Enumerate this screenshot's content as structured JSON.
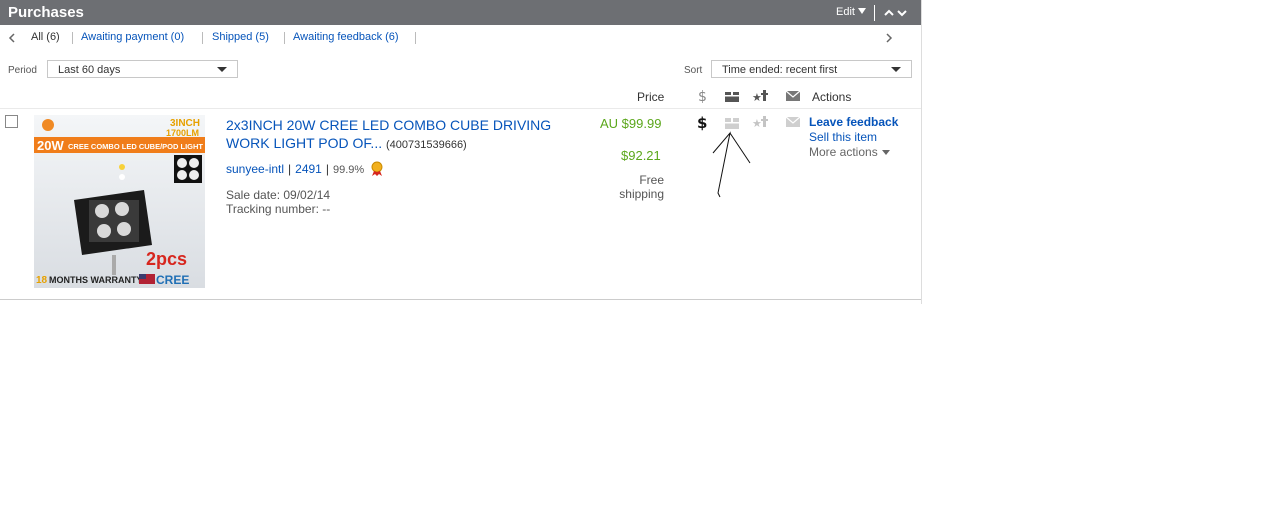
{
  "header": {
    "title": "Purchases",
    "edit_label": "Edit"
  },
  "tabs": [
    {
      "label": "All (6)"
    },
    {
      "label": "Awaiting payment (0)"
    },
    {
      "label": "Shipped (5)"
    },
    {
      "label": "Awaiting feedback (6)"
    }
  ],
  "filters": {
    "period_label": "Period",
    "period_value": "Last 60 days",
    "sort_label": "Sort",
    "sort_value": "Time ended: recent first"
  },
  "columns": {
    "price": "Price",
    "actions": "Actions"
  },
  "item": {
    "title": "2x3INCH 20W CREE LED COMBO CUBE DRIVING WORK LIGHT POD OF...",
    "item_number": "(400731539666)",
    "seller": "sunyee-intl",
    "feedback_score": "2491",
    "feedback_percent": "99.9%",
    "sale_date": "Sale date: 09/02/14",
    "tracking": "Tracking number: --",
    "price": "AU $99.99",
    "converted_price": "$92.21",
    "shipping": "Free shipping",
    "image_text": {
      "size": "3INCH",
      "lumens": "1700LM",
      "watt": "20W",
      "banner": "CREE COMBO LED CUBE/POD LIGHT",
      "qty": "2pcs",
      "warranty_num": "18",
      "warranty_text": "MONTHS WARRANTY",
      "brand": "CREE"
    }
  },
  "actions": {
    "leave_feedback": "Leave feedback",
    "sell_item": "Sell this item",
    "more_actions": "More actions"
  },
  "colors": {
    "header_bg": "#6d6f73",
    "link": "#0654ba",
    "price_green": "#5ba71b"
  },
  "icons": [
    "chevron-left-icon",
    "chevron-right-icon",
    "dollar-icon",
    "package-icon",
    "star-feedback-icon",
    "envelope-icon",
    "top-rated-medal-icon"
  ]
}
